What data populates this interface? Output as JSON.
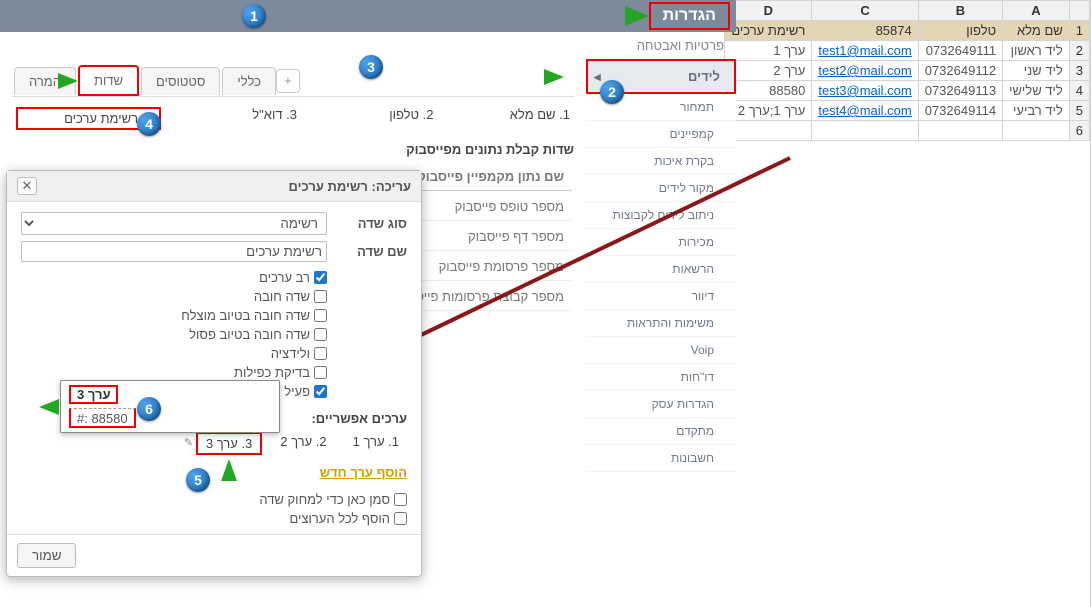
{
  "header": {
    "title": "הגדרות"
  },
  "breadcrumb": "פרטיות ואבטחה",
  "sidebar": {
    "active": "לידים",
    "subs": [
      "תמחור",
      "קמפיינים",
      "בקרת איכות",
      "‏מקור לידים",
      "ניתוב לידים לקבוצות",
      "מכירות",
      "הרשאות",
      "דיוור",
      "משימות והתראות",
      "Voip",
      "דו\"חות",
      "הגדרות עסק",
      "מתקדם",
      "חשבונות"
    ]
  },
  "tabs": {
    "items": [
      "כללי",
      "סטטוסים",
      "שדות",
      "המרה"
    ],
    "add": "+"
  },
  "fieldCols": [
    "1.  שם מלא",
    "2.  טלפון",
    "3.  דוא\"ל",
    "4.  רשימת ערכים"
  ],
  "fbSection": {
    "title": "שדות קבלת נתונים מפייסבוק",
    "colhead": "שם נתון מקמפיין פייסבוק",
    "rows": [
      "מספר טופס פייסבוק",
      "מספר דף פייסבוק",
      "מספר פרסומת פייסבוק",
      "מספר קבוצת פרסומות פייסבוק"
    ]
  },
  "dialog": {
    "title": "עריכה: רשימת ערכים",
    "fieldTypeLabel": "סוג שדה",
    "fieldTypeValue": "רשימה",
    "fieldNameLabel": "שם שדה",
    "fieldNameValue": "רשימת ערכים",
    "checks": [
      "רב ערכים",
      "שדה חובה",
      "שדה חובה בטיוב מוצלח",
      "שדה חובה בטיוב פסול",
      "ולידציה",
      "בדיקת כפילות",
      "פעיל"
    ],
    "tooltip": {
      "top": "ערך 3",
      "bot": "#: 88580"
    },
    "valuesTitle": "ערכים אפשריים:",
    "values": [
      "1.  ערך 1",
      "2.  ערך 2",
      "3.  ערך 3"
    ],
    "addValue": "הוסף ערך חדש",
    "finalChecks": [
      "סמן כאן כדי למחוק שדה",
      "הוסף לכל הערוצים"
    ],
    "save": "שמור"
  },
  "excel": {
    "cols": [
      "A",
      "B",
      "C",
      "D"
    ],
    "header": [
      "שם מלא",
      "טלפון",
      "85874",
      "רשימת ערכים"
    ],
    "rows": [
      {
        "n": "2",
        "a": "ליד ראשון",
        "b": "0732649111",
        "c": "test1@mail.com",
        "d": "ערך 1"
      },
      {
        "n": "3",
        "a": "ליד שני",
        "b": "0732649112",
        "c": "test2@mail.com",
        "d": "ערך 2"
      },
      {
        "n": "4",
        "a": "ליד שלישי",
        "b": "0732649113",
        "c": "test3@mail.com",
        "d": "88580"
      },
      {
        "n": "5",
        "a": "ליד רביעי",
        "b": "0732649114",
        "c": "test4@mail.com",
        "d": "ערך 1;ערך 2"
      },
      {
        "n": "6",
        "a": "",
        "b": "",
        "c": "",
        "d": ""
      }
    ]
  },
  "steps": {
    "1": "1",
    "2": "2",
    "3": "3",
    "4": "4",
    "5": "5",
    "6": "6"
  }
}
